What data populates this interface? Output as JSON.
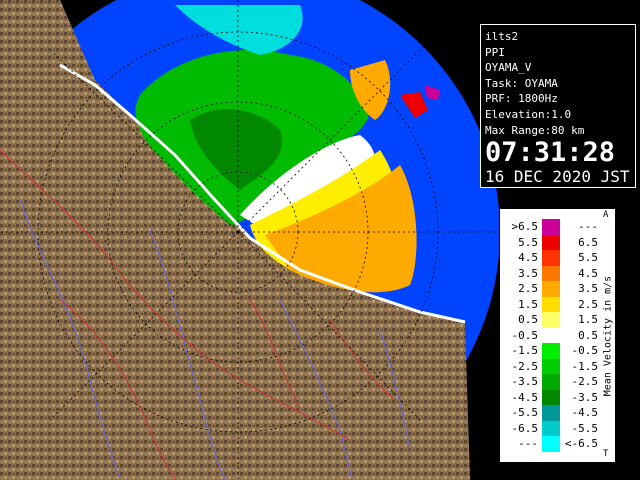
{
  "info": {
    "site": "ilts2",
    "product": "PPI",
    "radar": "OYAMA_V",
    "task": "Task: OYAMA",
    "prf": "PRF: 1800Hz",
    "elevation": "Elevation:1.0",
    "max_range": "Max Range:80 km",
    "time": "07:31:28",
    "date": "16 DEC 2020 JST"
  },
  "legend": {
    "title": "Mean Velocity in m/s",
    "top_mark": "A",
    "bottom_mark": "T",
    "rows": [
      {
        "lo": ">6.5",
        "hi": "---",
        "color": "#cc0099"
      },
      {
        "lo": "5.5",
        "hi": "6.5",
        "color": "#ee0000"
      },
      {
        "lo": "4.5",
        "hi": "5.5",
        "color": "#ff3300"
      },
      {
        "lo": "3.5",
        "hi": "4.5",
        "color": "#ff7700"
      },
      {
        "lo": "2.5",
        "hi": "3.5",
        "color": "#ffaa00"
      },
      {
        "lo": "1.5",
        "hi": "2.5",
        "color": "#ffdd00"
      },
      {
        "lo": "0.5",
        "hi": "1.5",
        "color": "#ffff66"
      },
      {
        "lo": "-0.5",
        "hi": "0.5",
        "color": "#ffffff"
      },
      {
        "lo": "-1.5",
        "hi": "-0.5",
        "color": "#00ee00"
      },
      {
        "lo": "-2.5",
        "hi": "-1.5",
        "color": "#00cc00"
      },
      {
        "lo": "-3.5",
        "hi": "-2.5",
        "color": "#00aa00"
      },
      {
        "lo": "-4.5",
        "hi": "-3.5",
        "color": "#008800"
      },
      {
        "lo": "-5.5",
        "hi": "-4.5",
        "color": "#009999"
      },
      {
        "lo": "-6.5",
        "hi": "-5.5",
        "color": "#00cccc"
      },
      {
        "lo": "---",
        "hi": "<-6.5",
        "color": "#00ffff"
      }
    ]
  },
  "colors": {
    "sea": "#0044ff",
    "land": "#8a6d4a",
    "rivers": "#6666dd",
    "borders": "#cc3333"
  }
}
